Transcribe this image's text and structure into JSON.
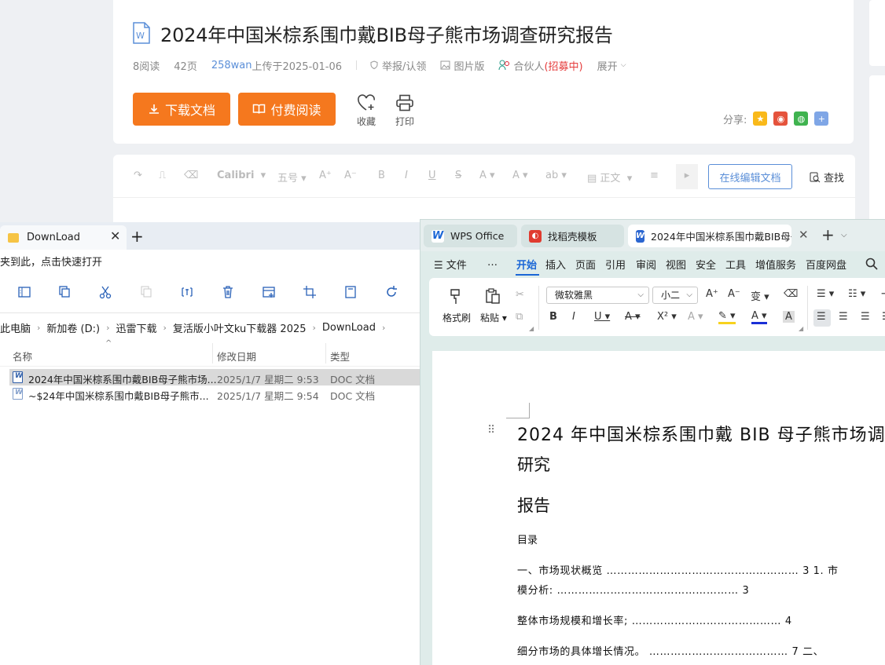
{
  "webpage": {
    "doc_title": "2024年中国米棕系围巾戴BIB母子熊市场调查研究报告",
    "meta": {
      "reads": "8阅读",
      "pages": "42页",
      "uploader": "258wan",
      "upload_date": "上传于2025-01-06",
      "report": "举报/认领",
      "image_version": "图片版",
      "partner": "合伙人",
      "recruiting": "(招募中)",
      "expand": "展开"
    },
    "download_label": "下载文档",
    "pay_read_label": "付费阅读",
    "favorite_label": "收藏",
    "print_label": "打印",
    "share_label": "分享:",
    "editor_toolbar": {
      "font": "Calibri",
      "size": "五号",
      "style": "正文",
      "online_edit": "在线编辑文档",
      "find": "查找"
    },
    "accent_color": "#f5781e",
    "link_color": "#5b8fd8"
  },
  "explorer": {
    "tab_title": "DownLoad",
    "hint": "夹到此，点击快速打开",
    "breadcrumb": [
      "此电脑",
      "新加卷 (D:)",
      "迅雷下载",
      "复活版小叶文ku下载器 2025",
      "DownLoad"
    ],
    "columns": {
      "name": "名称",
      "modified": "修改日期",
      "type": "类型"
    },
    "files": [
      {
        "name": "2024年中国米棕系围巾戴BIB母子熊市场...",
        "modified": "2025/1/7 星期二 9:53",
        "type": "DOC 文档",
        "selected": true
      },
      {
        "name": "~$24年中国米棕系围巾戴BIB母子熊市...",
        "modified": "2025/1/7 星期二 9:54",
        "type": "DOC 文档",
        "selected": false
      }
    ]
  },
  "wps": {
    "tabs": {
      "home": "WPS Office",
      "templates": "找稻壳模板",
      "doc": "2024年中国米棕系围巾戴BIB母子熊"
    },
    "menu": [
      "文件",
      "…",
      "开始",
      "插入",
      "页面",
      "引用",
      "审阅",
      "视图",
      "安全",
      "工具",
      "增值服务",
      "百度网盘"
    ],
    "ribbon": {
      "format_painter": "格式刷",
      "paste": "粘贴",
      "font_name": "微软雅黑",
      "font_size": "小二"
    },
    "document": {
      "title_line1": "2024 年中国米棕系围巾戴 BIB 母子熊市场调",
      "title_line2": "研究",
      "title_line3": "报告",
      "toc_label": "目录",
      "toc_lines": [
        "一、市场现状概览 ……………………………………………… 3 1. 市",
        "模分析: …………………………………………… 3",
        "整体市场规模和增长率; …………………………………… 4",
        "细分市场的具体增长情况。 ………………………………… 7 二、"
      ]
    },
    "accent_color": "#1a66d6"
  }
}
